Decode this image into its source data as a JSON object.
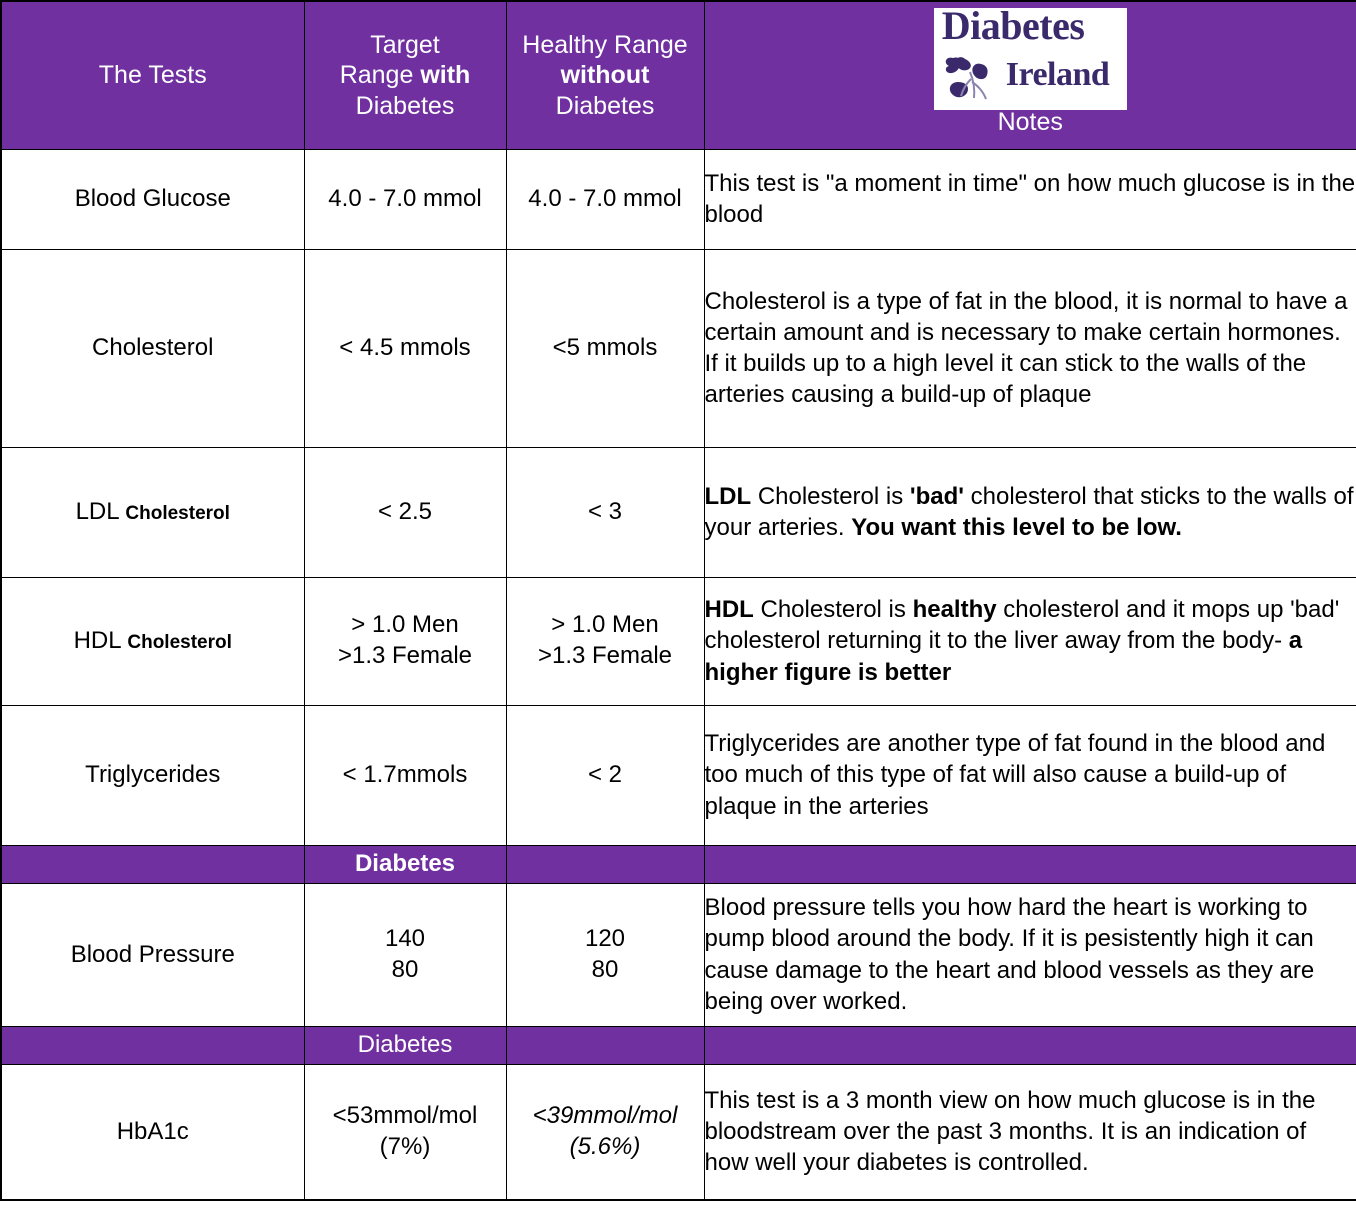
{
  "colors": {
    "brand_purple": "#7030A0",
    "logo_navy": "#3B2A6B",
    "border": "#000000",
    "header_text": "#FFFFFF"
  },
  "header": {
    "tests_label": "The Tests",
    "target_line_1": "Target",
    "target_line_2a": "Range ",
    "target_line_2b": "with",
    "target_line_3": "Diabetes",
    "healthy_line_1": "Healthy Range",
    "healthy_line_2": "without",
    "healthy_line_3": "Diabetes",
    "notes_label": "Notes",
    "logo": {
      "line_1": "Diabetes",
      "line_2": "Ireland",
      "icon": "shamrock-flower-icon"
    }
  },
  "rows": [
    {
      "kind": "data",
      "test_main": "Blood Glucose",
      "test_sub": "",
      "target": "4.0 - 7.0 mmol",
      "healthy": "4.0 - 7.0 mmol",
      "healthy_italic": false,
      "notes_html": "This test is \"a moment in time\" on how much glucose is in the blood"
    },
    {
      "kind": "data",
      "test_main": "Cholesterol",
      "test_sub": "",
      "target": "< 4.5 mmols",
      "healthy": "<5 mmols",
      "healthy_italic": false,
      "notes_html": "Cholesterol is a type of fat in the blood, it is normal to have a certain amount and is necessary to make certain hormones. If it builds up to a high level it can stick to the walls of the arteries causing a build-up of plaque"
    },
    {
      "kind": "data",
      "test_main": "LDL",
      "test_sub": "Cholesterol",
      "target": "< 2.5",
      "healthy": "< 3",
      "healthy_italic": false,
      "notes_html": "<b>LDL</b> Cholesterol is <b>'bad'</b> cholesterol that sticks to the walls of your arteries. <b>You want this level to be low.</b>"
    },
    {
      "kind": "data",
      "test_main": "HDL",
      "test_sub": "Cholesterol",
      "target": "> 1.0 Men\n>1.3 Female",
      "healthy": "> 1.0 Men\n>1.3 Female",
      "healthy_italic": false,
      "notes_html": "<b>HDL</b> Cholesterol is <b>healthy</b> cholesterol and it mops up 'bad' cholesterol returning it to the liver away from the body- <b>a higher figure is better</b>"
    },
    {
      "kind": "data",
      "test_main": "Triglycerides",
      "test_sub": "",
      "target": "< 1.7mmols",
      "healthy": "< 2",
      "healthy_italic": false,
      "notes_html": "Triglycerides are another type of fat found in the blood and too much of this type of fat will also cause a build-up of plaque in the arteries"
    },
    {
      "kind": "band",
      "label": "Diabetes",
      "bold": true
    },
    {
      "kind": "data",
      "test_main": "Blood Pressure",
      "test_sub": "",
      "target": "140\n80",
      "healthy": "120\n80",
      "healthy_italic": false,
      "notes_html": "Blood pressure tells you how hard the heart is working to pump blood around the body. If it is pesistently high it can cause damage to the heart and blood vessels as they are being over worked."
    },
    {
      "kind": "band",
      "label": "Diabetes",
      "bold": false
    },
    {
      "kind": "data",
      "test_main": "HbA1c",
      "test_sub": "",
      "target": "<53mmol/mol\n(7%)",
      "healthy": "<39mmol/mol\n(5.6%)",
      "healthy_italic": true,
      "notes_html": "This test is a 3 month view on how much glucose is in the bloodstream over the past 3 months. It is an indication of how well your diabetes is controlled."
    }
  ]
}
